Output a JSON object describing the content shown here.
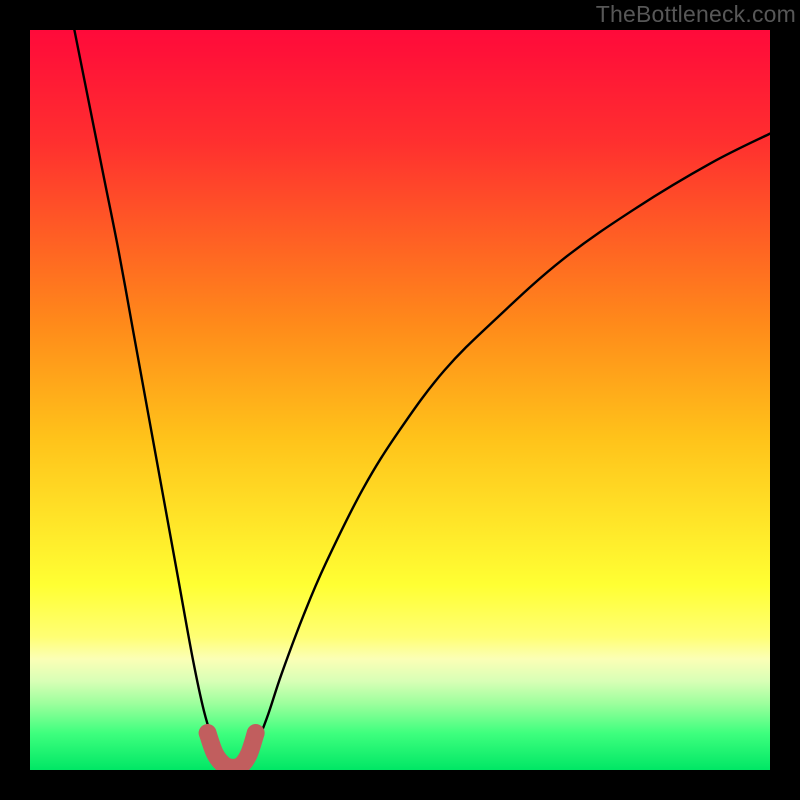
{
  "watermark": "TheBottleneck.com",
  "colors": {
    "background": "#000000",
    "gradient_stops": [
      {
        "offset": 0.0,
        "color": "#ff0a3a"
      },
      {
        "offset": 0.15,
        "color": "#ff2f2f"
      },
      {
        "offset": 0.4,
        "color": "#ff8b1a"
      },
      {
        "offset": 0.55,
        "color": "#ffc21a"
      },
      {
        "offset": 0.75,
        "color": "#ffff33"
      },
      {
        "offset": 0.82,
        "color": "#ffff74"
      },
      {
        "offset": 0.85,
        "color": "#fbffb6"
      },
      {
        "offset": 0.88,
        "color": "#d8ffb6"
      },
      {
        "offset": 0.91,
        "color": "#9dff9d"
      },
      {
        "offset": 0.95,
        "color": "#3fff7e"
      },
      {
        "offset": 1.0,
        "color": "#00e765"
      }
    ],
    "curve": "#000000",
    "marker_fill": "#c15e5e",
    "marker_stroke": "#c15e5e"
  },
  "chart_data": {
    "type": "line",
    "title": "",
    "xlabel": "",
    "ylabel": "",
    "xlim": [
      0,
      100
    ],
    "ylim": [
      0,
      100
    ],
    "grid": false,
    "legend": false,
    "series": [
      {
        "name": "left-branch",
        "x": [
          6,
          8,
          10,
          12,
          14,
          16,
          18,
          20,
          22,
          23.5,
          25,
          26
        ],
        "y": [
          100,
          90,
          80,
          70,
          59,
          48,
          37,
          26,
          15,
          8,
          3,
          0
        ]
      },
      {
        "name": "right-branch",
        "x": [
          29,
          30,
          32,
          34,
          37,
          40,
          45,
          50,
          56,
          63,
          72,
          82,
          92,
          100
        ],
        "y": [
          0,
          2,
          7,
          13,
          21,
          28,
          38,
          46,
          54,
          61,
          69,
          76,
          82,
          86
        ]
      }
    ],
    "markers": [
      {
        "name": "left-dot",
        "x": 24.0,
        "y": 5.0,
        "r": 1.2
      },
      {
        "name": "right-dot",
        "x": 30.5,
        "y": 5.0,
        "r": 1.2
      }
    ],
    "thick_path": {
      "name": "valley-floor",
      "stroke_width": 2.4,
      "points": [
        {
          "x": 24.0,
          "y": 5.0
        },
        {
          "x": 25.0,
          "y": 2.2
        },
        {
          "x": 26.2,
          "y": 0.7
        },
        {
          "x": 27.4,
          "y": 0.3
        },
        {
          "x": 28.6,
          "y": 0.7
        },
        {
          "x": 29.6,
          "y": 2.2
        },
        {
          "x": 30.5,
          "y": 5.0
        }
      ]
    }
  }
}
